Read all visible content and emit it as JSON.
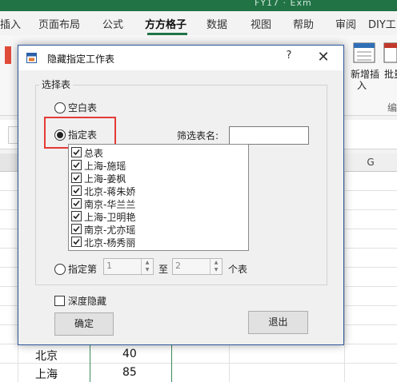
{
  "excel": {
    "title_fragment": "FY17 · Exm",
    "tabs": [
      "插入",
      "页面布局",
      "公式",
      "方方格子",
      "数据",
      "视图",
      "帮助",
      "审阅",
      "DIY工"
    ],
    "active_tab": "方方格子",
    "ribbon_labels": [
      "新增插",
      "入",
      "批量",
      "编"
    ],
    "col_header_g": "G",
    "cells": [
      {
        "city": "北京",
        "value": "40"
      },
      {
        "city": "上海",
        "value": "85"
      }
    ]
  },
  "dialog": {
    "title": "隐藏指定工作表",
    "help": "?",
    "close": "✕",
    "group_label": "选择表",
    "radio_blank": "空白表",
    "radio_specified": "指定表",
    "filter_label": "筛选表名:",
    "filter_value": "",
    "sheets": [
      {
        "name": "总表",
        "checked": true
      },
      {
        "name": "上海-施瑶",
        "checked": true
      },
      {
        "name": "上海-姜枫",
        "checked": true
      },
      {
        "name": "北京-蒋朱娇",
        "checked": true
      },
      {
        "name": "南京-华兰兰",
        "checked": true
      },
      {
        "name": "上海-卫明艳",
        "checked": true
      },
      {
        "name": "南京-尤亦瑶",
        "checked": true
      },
      {
        "name": "北京-杨秀丽",
        "checked": true
      }
    ],
    "radio_nth": "指定第",
    "from_value": "1",
    "to_label": "至",
    "to_value": "2",
    "count_label": "个表",
    "deep_hide": "深度隐藏",
    "ok": "确定",
    "exit": "退出"
  }
}
